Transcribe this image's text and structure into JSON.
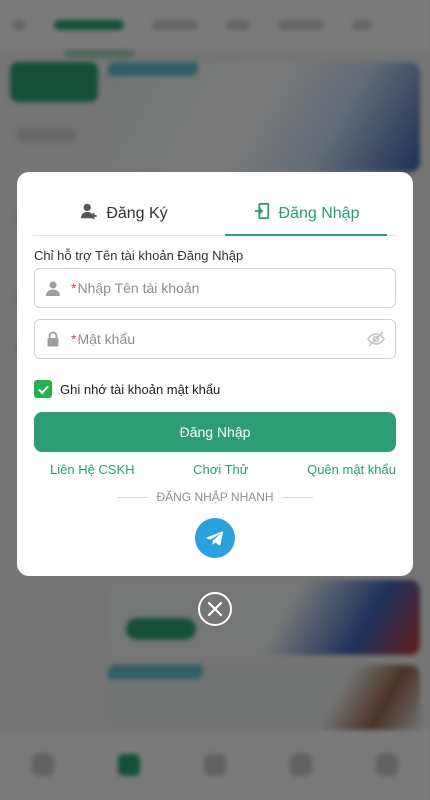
{
  "colors": {
    "accent": "#2a9d73",
    "button": "#2d9d75",
    "required": "#e33b3b",
    "checkbox": "#22b14c",
    "telegram": "#2aa1da"
  },
  "tabs": [
    {
      "label": "Đăng Ký",
      "icon": "user-plus-icon",
      "active": false
    },
    {
      "label": "Đăng Nhập",
      "icon": "login-door-icon",
      "active": true
    }
  ],
  "form": {
    "hint": "Chỉ hỗ trợ Tên tài khoản Đăng Nhập",
    "username": {
      "required_mark": "*",
      "placeholder": "Nhập Tên tài khoản",
      "value": "",
      "icon": "user-icon"
    },
    "password": {
      "required_mark": "*",
      "placeholder": "Mật khẩu",
      "value": "",
      "icon": "lock-icon",
      "toggle_icon": "eye-off-icon"
    },
    "remember": {
      "label": "Ghi nhớ tài khoản mật khẩu",
      "checked": true
    },
    "submit_label": "Đăng Nhập"
  },
  "links": {
    "support": "Liên Hệ CSKH",
    "trial": "Chơi Thử",
    "forgot": "Quên mật khẩu"
  },
  "quick_login": {
    "label": "ĐĂNG NHẬP NHANH",
    "icon": "telegram-icon"
  },
  "close_icon": "close-icon"
}
